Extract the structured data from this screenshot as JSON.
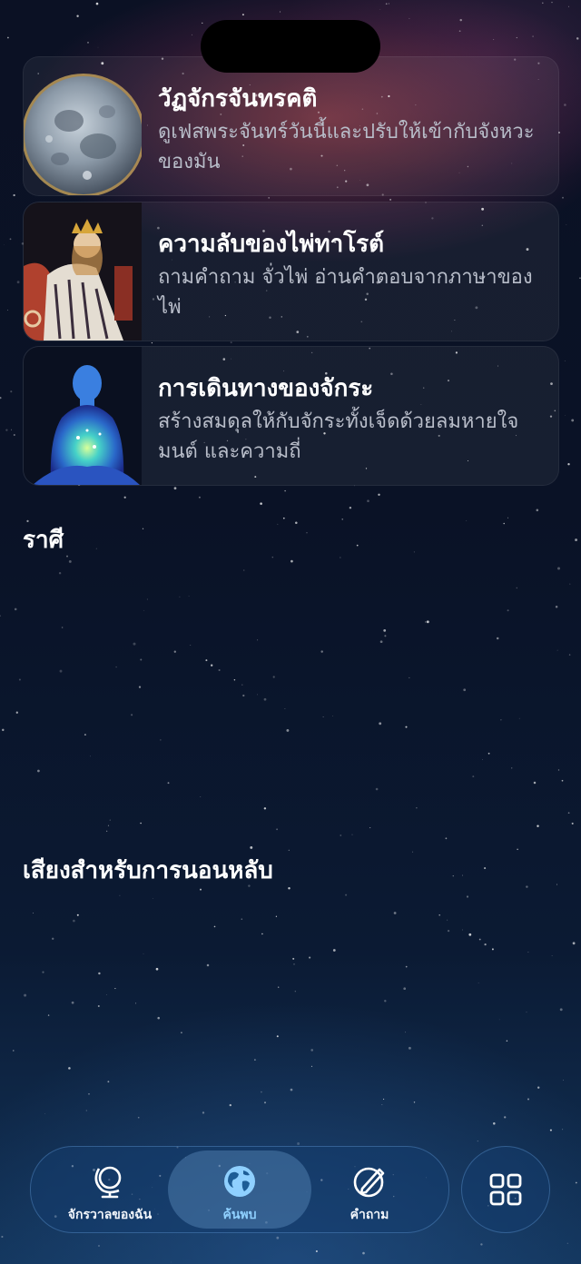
{
  "cards": [
    {
      "title": "วัฏจักรจันทรคติ",
      "description": "ดูเฟสพระจันทร์วันนี้และปรับให้เข้ากับจังหวะของมัน",
      "image": "full-moon"
    },
    {
      "title": "ความลับของไพ่ทาโรต์",
      "description": "ถามคำถาม จั่วไพ่ อ่านคำตอบจากภาษาของไพ่",
      "image": "tarot-empress-card"
    },
    {
      "title": "การเดินทางของจักระ",
      "description": "สร้างสมดุลให้กับจักระทั้งเจ็ดด้วยลมหายใจ มนต์ และความถี่",
      "image": "glowing-meditating-figure"
    }
  ],
  "sections": {
    "zodiac": "ราศี",
    "sleep_sounds": "เสียงสำหรับการนอนหลับ"
  },
  "tabbar": {
    "tabs": [
      {
        "label": "จักรวาลของฉัน",
        "icon": "globe-stand-icon",
        "active": false
      },
      {
        "label": "ค้นพบ",
        "icon": "earth-icon",
        "active": true
      },
      {
        "label": "คำถาม",
        "icon": "compass-pencil-icon",
        "active": false
      }
    ],
    "menu_icon": "grid-icon"
  },
  "colors": {
    "active_tab_label": "#8fd0ff",
    "card_background": "rgba(255,255,255,0.055)",
    "description_text": "#b8bdc9"
  }
}
